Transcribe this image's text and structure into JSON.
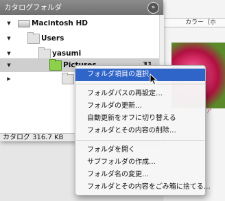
{
  "palette": {
    "title": "カタログフォルダ",
    "collapse_icon": "chevron-collapse-icon",
    "tree": [
      {
        "label": "Macintosh HD",
        "icon": "hard-drive-icon",
        "expanded": true
      },
      {
        "label": "Users",
        "icon": "folder-icon",
        "expanded": true
      },
      {
        "label": "yasumi",
        "icon": "folder-icon",
        "expanded": true
      },
      {
        "label": "Pictures",
        "icon": "folder-green-icon",
        "expanded": true,
        "count": "31",
        "selected": true
      },
      {
        "label": "",
        "icon": "folder-icon",
        "expanded": false
      }
    ],
    "status": "カタログ  316.7 KB"
  },
  "background": {
    "column_header": "カラー（ホ"
  },
  "context_menu": {
    "items_group1": [
      "フォルダ項目の選択"
    ],
    "items_group2": [
      "フォルダパスの再設定…",
      "フォルダの更新…",
      "自動更新をオフに切り替える",
      "フォルダとその内容の削除…"
    ],
    "items_group3": [
      "フォルダを開く",
      "サブフォルダの作成…",
      "フォルダ名の変更…",
      "フォルダとその内容をごみ箱に捨てる…"
    ],
    "highlight_color": "#2f64c8"
  }
}
